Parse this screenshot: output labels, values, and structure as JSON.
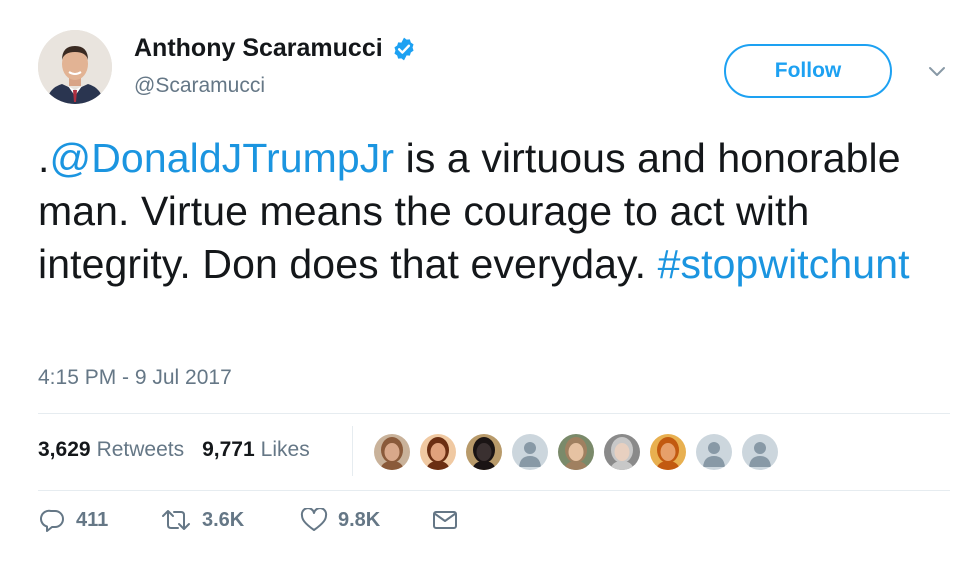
{
  "author": {
    "name": "Anthony Scaramucci",
    "handle": "@Scaramucci",
    "verified": true
  },
  "follow_button": {
    "label": "Follow"
  },
  "tweet": {
    "text_parts": [
      {
        "text": ".",
        "type": "plain"
      },
      {
        "text": "@DonaldJTrumpJr",
        "type": "mention"
      },
      {
        "text": " is a virtuous and honorable man. Virtue means the courage to act with integrity. Don does that everyday. ",
        "type": "plain"
      },
      {
        "text": "#stopwitchunt",
        "type": "hashtag"
      }
    ],
    "timestamp": "4:15 PM - 9 Jul 2017"
  },
  "stats": {
    "retweets_count": "3,629",
    "retweets_label": "Retweets",
    "likes_count": "9,771",
    "likes_label": "Likes"
  },
  "liked_by_avatars": [
    {
      "kind": "photo",
      "skin": "#d9a88a",
      "hair": "#8a5a3a",
      "bg": "#c9b29a"
    },
    {
      "kind": "photo",
      "skin": "#e0a17c",
      "hair": "#6b2e12",
      "bg": "#f0c9a2"
    },
    {
      "kind": "photo",
      "skin": "#3a3030",
      "hair": "#1a1414",
      "bg": "#b89a6a"
    },
    {
      "kind": "default"
    },
    {
      "kind": "photo",
      "skin": "#e6c2a2",
      "hair": "#a08060",
      "bg": "#7a8a6a"
    },
    {
      "kind": "photo",
      "skin": "#e8d0c0",
      "hair": "#c8c8c8",
      "bg": "#8a8a8a"
    },
    {
      "kind": "photo",
      "skin": "#e7a06a",
      "hair": "#c25a10",
      "bg": "#e8b050"
    },
    {
      "kind": "default"
    },
    {
      "kind": "default"
    }
  ],
  "actions": {
    "reply_count": "411",
    "retweet_count": "3.6K",
    "like_count": "9.8K"
  },
  "colors": {
    "link": "#1b95e0",
    "accent": "#1da1f2",
    "muted": "#657786",
    "divider": "#e6ecf0"
  },
  "icons": [
    "verified-badge-icon",
    "chevron-down-icon",
    "reply-icon",
    "retweet-icon",
    "heart-icon",
    "message-icon"
  ]
}
